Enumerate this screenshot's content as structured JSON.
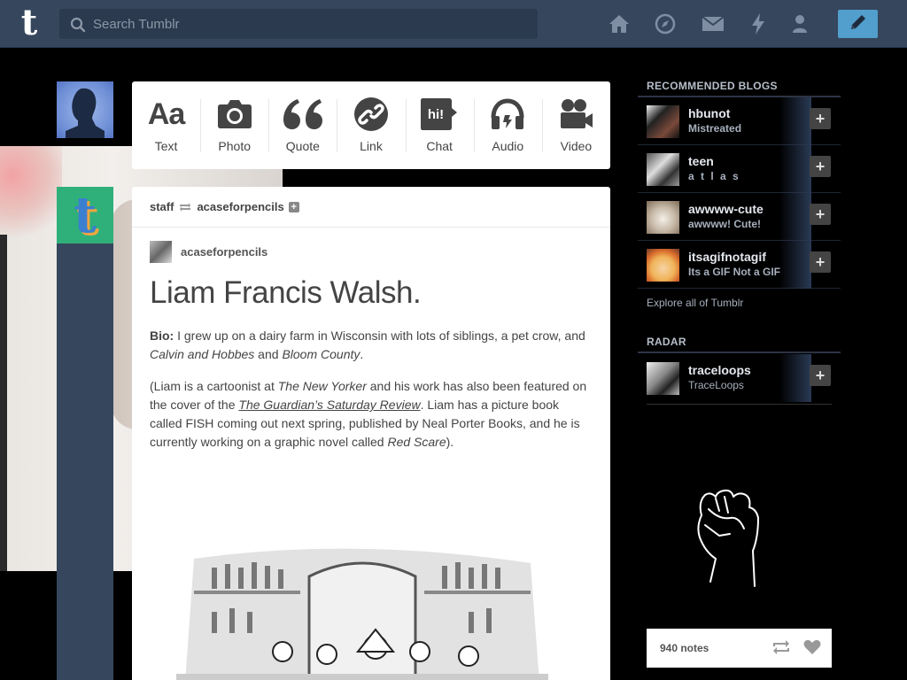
{
  "header": {
    "logo": "t",
    "search_placeholder": "Search Tumblr",
    "icons": [
      "home-icon",
      "compass-icon",
      "mail-icon",
      "lightning-icon",
      "account-icon",
      "compose-pencil-icon"
    ],
    "accent": "#529ecc",
    "bar_color": "#36465d"
  },
  "post_types": [
    {
      "label": "Text",
      "icon": "Aa"
    },
    {
      "label": "Photo",
      "icon": "camera-icon"
    },
    {
      "label": "Quote",
      "icon": "quote-icon"
    },
    {
      "label": "Link",
      "icon": "link-icon"
    },
    {
      "label": "Chat",
      "icon": "chat-icon",
      "badge": "hi!"
    },
    {
      "label": "Audio",
      "icon": "headphones-icon"
    },
    {
      "label": "Video",
      "icon": "video-camera-icon"
    }
  ],
  "post": {
    "reblogged_by": "staff",
    "reblogged_from": "acaseforpencils",
    "source_name": "acaseforpencils",
    "title": "Liam Francis Walsh.",
    "bio_label": "Bio:",
    "bio_text_1": " I grew up on a dairy farm in Wisconsin with lots of siblings, a pet crow, and ",
    "bio_em_1": "Calvin and Hobbes",
    "bio_text_2": " and ",
    "bio_em_2": "Bloom County",
    "bio_text_3": ".",
    "p2_1": "(Liam is a cartoonist at ",
    "p2_em_1": "The New Yorker",
    "p2_2": " and his work has also been featured on the cover of the ",
    "p2_link": "The Guardian’s Saturday Review",
    "p2_3": ". Liam has a picture book called FISH coming out next spring, published by Neal Porter Books, and he is currently working on a graphic novel called ",
    "p2_em_2": "Red Scare",
    "p2_4": ")."
  },
  "sidebar": {
    "recommended_title": "RECOMMENDED BLOGS",
    "blogs": [
      {
        "name": "hbunot",
        "subtitle": "Mistreated"
      },
      {
        "name": "teen",
        "subtitle": "a t l a s"
      },
      {
        "name": "awwww-cute",
        "subtitle": "awwww! Cute!"
      },
      {
        "name": "itsagifnotagif",
        "subtitle": "Its a GIF Not a GIF"
      }
    ],
    "explore_link": "Explore all of Tumblr",
    "radar_title": "RADAR",
    "radar_blog": {
      "name": "traceloops",
      "subtitle": "TraceLoops"
    },
    "radar_notes": "940 notes"
  }
}
